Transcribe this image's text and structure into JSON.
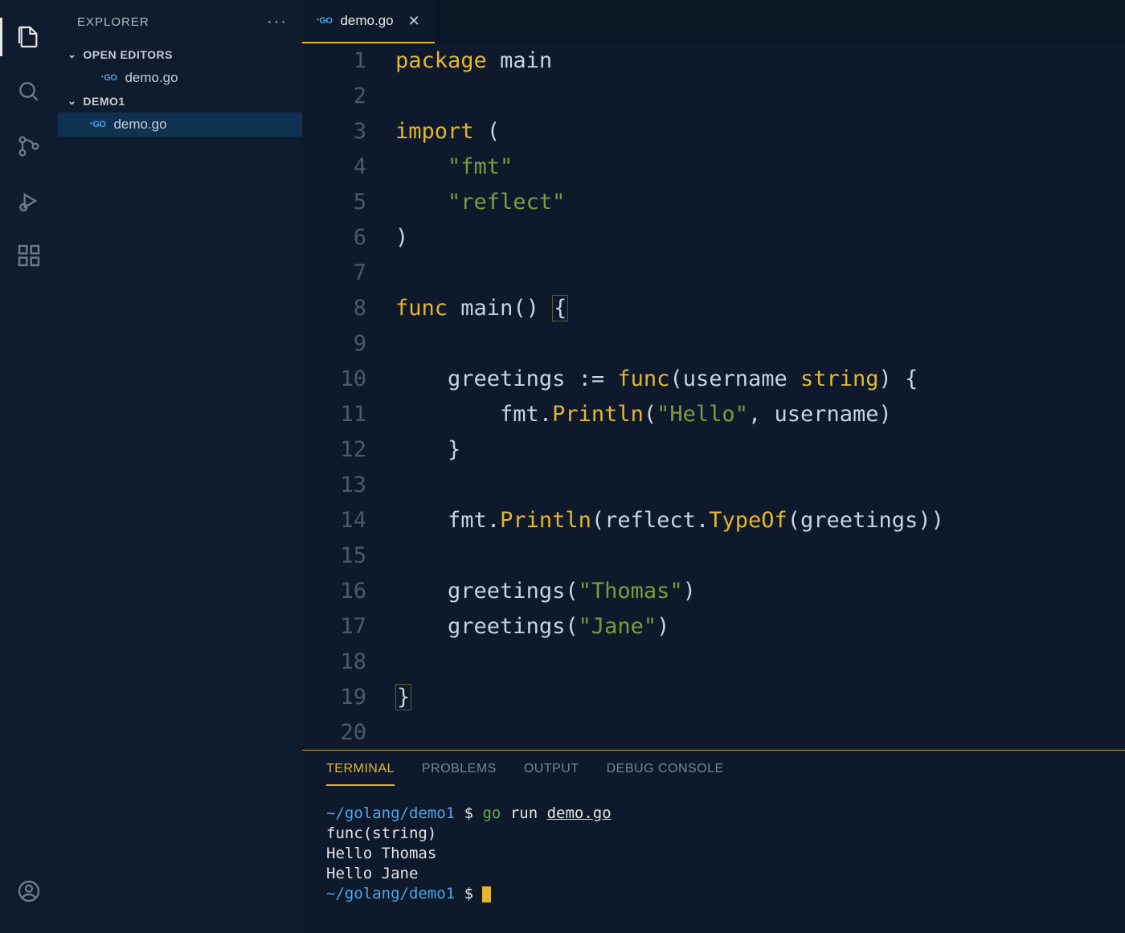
{
  "activityBar": {
    "items": [
      "explorer",
      "search",
      "source-control",
      "debug",
      "extensions"
    ],
    "account": "account"
  },
  "sidebar": {
    "title": "EXPLORER",
    "openEditors": {
      "label": "OPEN EDITORS",
      "items": [
        {
          "lang": "GO",
          "name": "demo.go"
        }
      ]
    },
    "folder": {
      "label": "DEMO1",
      "items": [
        {
          "lang": "GO",
          "name": "demo.go"
        }
      ]
    }
  },
  "tabs": {
    "active": {
      "lang": "GO",
      "name": "demo.go"
    }
  },
  "editor": {
    "lineCount": 20,
    "lines": [
      [
        {
          "c": "tok-kw",
          "t": "package"
        },
        {
          "c": "",
          "t": " "
        },
        {
          "c": "tok-id",
          "t": "main"
        }
      ],
      [],
      [
        {
          "c": "tok-kw",
          "t": "import"
        },
        {
          "c": "",
          "t": " "
        },
        {
          "c": "tok-pn",
          "t": "("
        }
      ],
      [
        {
          "c": "",
          "t": "    "
        },
        {
          "c": "tok-str",
          "t": "\"fmt\""
        }
      ],
      [
        {
          "c": "",
          "t": "    "
        },
        {
          "c": "tok-str",
          "t": "\"reflect\""
        }
      ],
      [
        {
          "c": "tok-pn",
          "t": ")"
        }
      ],
      [],
      [
        {
          "c": "tok-kw",
          "t": "func"
        },
        {
          "c": "",
          "t": " "
        },
        {
          "c": "tok-id",
          "t": "main"
        },
        {
          "c": "tok-pn",
          "t": "()"
        },
        {
          "c": "",
          "t": " "
        },
        {
          "c": "tok-pn brace-hl",
          "t": "{"
        }
      ],
      [],
      [
        {
          "c": "",
          "t": "    "
        },
        {
          "c": "tok-id",
          "t": "greetings"
        },
        {
          "c": "",
          "t": " "
        },
        {
          "c": "tok-pn",
          "t": ":="
        },
        {
          "c": "",
          "t": " "
        },
        {
          "c": "tok-kw",
          "t": "func"
        },
        {
          "c": "tok-pn",
          "t": "("
        },
        {
          "c": "tok-id",
          "t": "username"
        },
        {
          "c": "",
          "t": " "
        },
        {
          "c": "tok-ty",
          "t": "string"
        },
        {
          "c": "tok-pn",
          "t": ")"
        },
        {
          "c": "",
          "t": " "
        },
        {
          "c": "tok-pn",
          "t": "{"
        }
      ],
      [
        {
          "c": "",
          "t": "        "
        },
        {
          "c": "tok-id",
          "t": "fmt"
        },
        {
          "c": "tok-pn",
          "t": "."
        },
        {
          "c": "tok-call",
          "t": "Println"
        },
        {
          "c": "tok-pn",
          "t": "("
        },
        {
          "c": "tok-str",
          "t": "\"Hello\""
        },
        {
          "c": "tok-pn",
          "t": ","
        },
        {
          "c": "",
          "t": " "
        },
        {
          "c": "tok-id",
          "t": "username"
        },
        {
          "c": "tok-pn",
          "t": ")"
        }
      ],
      [
        {
          "c": "",
          "t": "    "
        },
        {
          "c": "tok-pn",
          "t": "}"
        }
      ],
      [],
      [
        {
          "c": "",
          "t": "    "
        },
        {
          "c": "tok-id",
          "t": "fmt"
        },
        {
          "c": "tok-pn",
          "t": "."
        },
        {
          "c": "tok-call",
          "t": "Println"
        },
        {
          "c": "tok-pn",
          "t": "("
        },
        {
          "c": "tok-id",
          "t": "reflect"
        },
        {
          "c": "tok-pn",
          "t": "."
        },
        {
          "c": "tok-call",
          "t": "TypeOf"
        },
        {
          "c": "tok-pn",
          "t": "("
        },
        {
          "c": "tok-id",
          "t": "greetings"
        },
        {
          "c": "tok-pn",
          "t": "))"
        }
      ],
      [],
      [
        {
          "c": "",
          "t": "    "
        },
        {
          "c": "tok-id",
          "t": "greetings"
        },
        {
          "c": "tok-pn",
          "t": "("
        },
        {
          "c": "tok-str",
          "t": "\"Thomas\""
        },
        {
          "c": "tok-pn",
          "t": ")"
        }
      ],
      [
        {
          "c": "",
          "t": "    "
        },
        {
          "c": "tok-id",
          "t": "greetings"
        },
        {
          "c": "tok-pn",
          "t": "("
        },
        {
          "c": "tok-str",
          "t": "\"Jane\""
        },
        {
          "c": "tok-pn",
          "t": ")"
        }
      ],
      [],
      [
        {
          "c": "tok-pn brace-hl",
          "t": "}"
        }
      ],
      []
    ]
  },
  "panel": {
    "tabs": [
      "TERMINAL",
      "PROBLEMS",
      "OUTPUT",
      "DEBUG CONSOLE"
    ],
    "activeTab": "TERMINAL",
    "terminal": {
      "prompt1": {
        "path": "~/golang/demo1",
        "dollar": " $ ",
        "cmd": "go",
        "args": " run ",
        "file": "demo.go"
      },
      "out1": "func(string)",
      "out2": "Hello Thomas",
      "out3": "Hello Jane",
      "prompt2": {
        "path": "~/golang/demo1",
        "dollar": " $ "
      }
    }
  }
}
